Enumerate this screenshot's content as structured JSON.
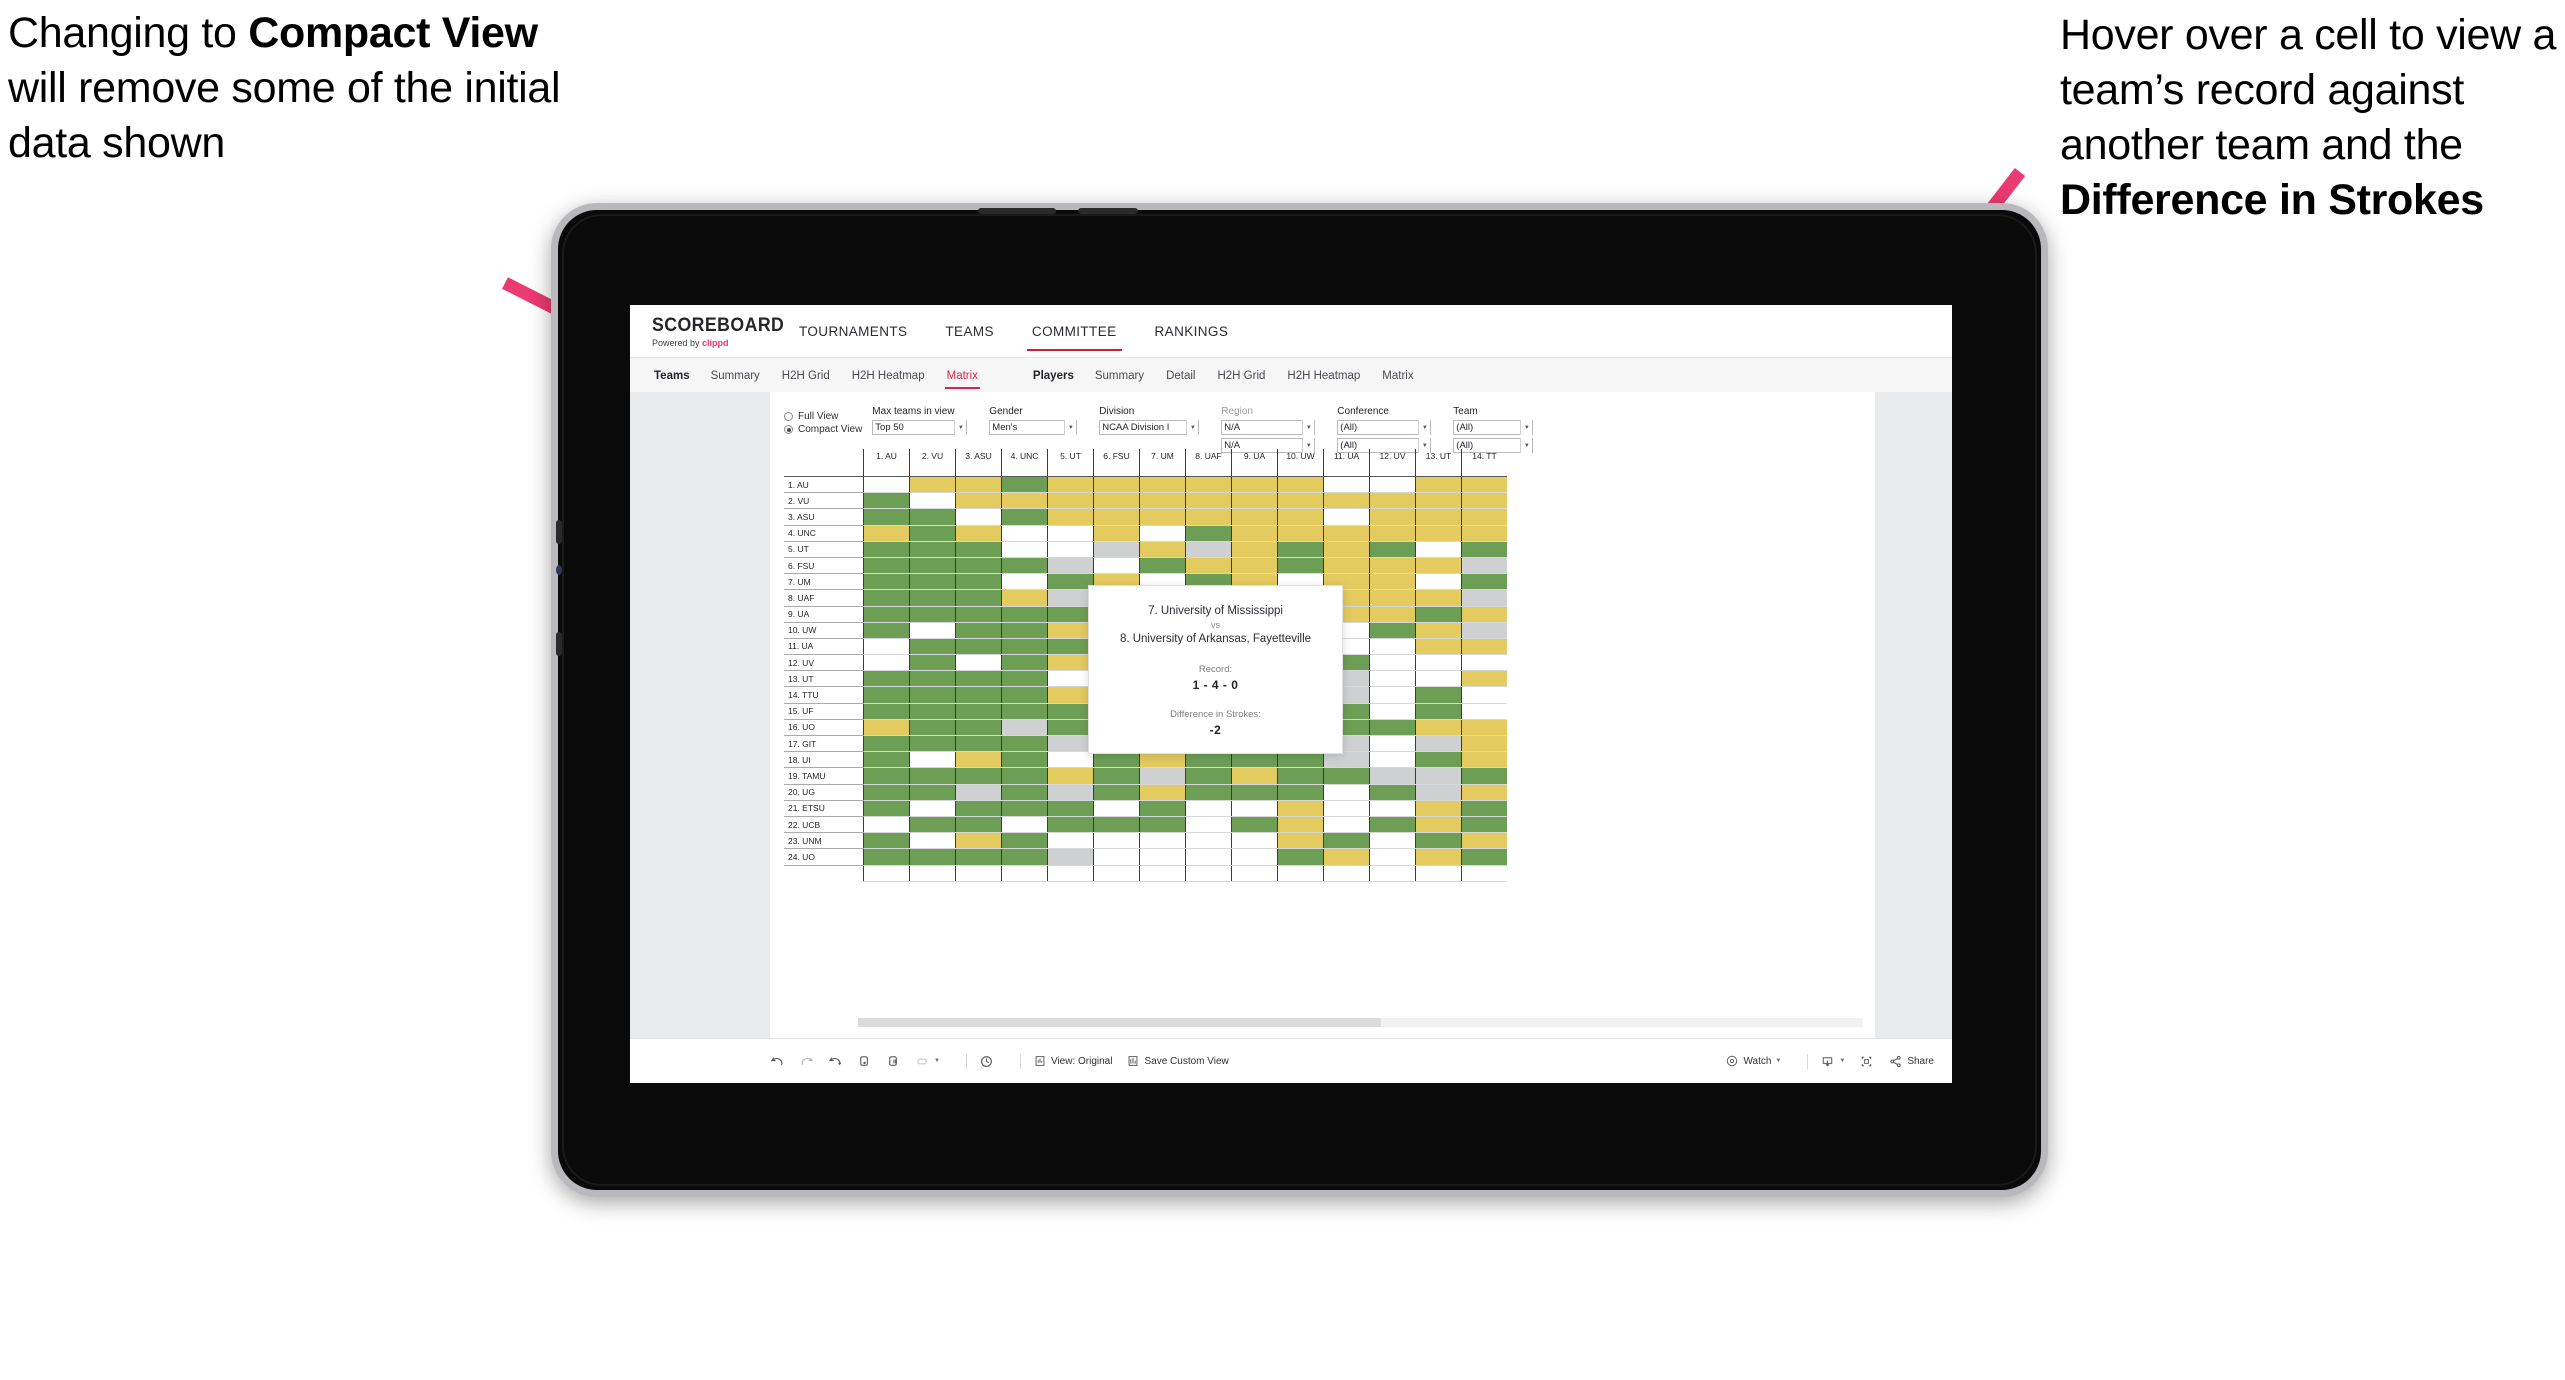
{
  "annotations": {
    "left": {
      "pre": "Changing to ",
      "bold": "Compact View",
      "post": " will remove some of the initial data shown"
    },
    "right": {
      "pre": "Hover over a cell to view a team’s record against another team and the ",
      "bold": "Difference in Strokes",
      "post": ""
    },
    "arrow_color": "#ec3a72"
  },
  "brand": {
    "logo": "SCOREBOARD",
    "tagline_pre": "Powered by ",
    "tagline_brand": "clippd"
  },
  "topnav": {
    "items": [
      {
        "label": "TOURNAMENTS",
        "active": false
      },
      {
        "label": "TEAMS",
        "active": false
      },
      {
        "label": "COMMITTEE",
        "active": true
      },
      {
        "label": "RANKINGS",
        "active": false
      }
    ]
  },
  "subnav": {
    "teams_group_label": "Teams",
    "teams_items": [
      {
        "label": "Summary",
        "active": false
      },
      {
        "label": "H2H Grid",
        "active": false
      },
      {
        "label": "H2H Heatmap",
        "active": false
      },
      {
        "label": "Matrix",
        "active": true
      }
    ],
    "players_group_label": "Players",
    "players_items": [
      {
        "label": "Summary",
        "active": false
      },
      {
        "label": "Detail",
        "active": false
      },
      {
        "label": "H2H Grid",
        "active": false
      },
      {
        "label": "H2H Heatmap",
        "active": false
      },
      {
        "label": "Matrix",
        "active": false
      }
    ]
  },
  "filters": {
    "view_mode": {
      "full_label": "Full View",
      "compact_label": "Compact View",
      "selected": "Compact View"
    },
    "max_teams": {
      "label": "Max teams in view",
      "value": "Top 50"
    },
    "gender": {
      "label": "Gender",
      "value": "Men's"
    },
    "division": {
      "label": "Division",
      "value": "NCAA Division I"
    },
    "region": {
      "label": "Region",
      "value1": "N/A",
      "value2": "N/A"
    },
    "conference": {
      "label": "Conference",
      "value1": "(All)",
      "value2": "(All)"
    },
    "team": {
      "label": "Team",
      "value1": "(All)",
      "value2": "(All)"
    }
  },
  "matrix": {
    "columns": [
      "1. AU",
      "2. VU",
      "3. ASU",
      "4. UNC",
      "5. UT",
      "6. FSU",
      "7. UM",
      "8. UAF",
      "9. UA",
      "10. UW",
      "11. UA",
      "12. UV",
      "13. UT",
      "14. TT"
    ],
    "rows": [
      "1. AU",
      "2. VU",
      "3. ASU",
      "4. UNC",
      "5. UT",
      "6. FSU",
      "7. UM",
      "8. UAF",
      "9. UA",
      "10. UW",
      "11. UA",
      "12. UV",
      "13. UT",
      "14. TTU",
      "15. UF",
      "16. UO",
      "17. GIT",
      "18. UI",
      "19. TAMU",
      "20. UG",
      "21. ETSU",
      "22. UCB",
      "23. UNM",
      "24. UO"
    ],
    "legend": {
      "win": "#6d9e55",
      "loss": "#e3cb5f",
      "tie": "#cfd0d2",
      "none": "#ffffff"
    },
    "cells": [
      [
        "w",
        "y",
        "y",
        "g",
        "y",
        "y",
        "y",
        "y",
        "y",
        "y",
        "w",
        "w",
        "y",
        "y"
      ],
      [
        "g",
        "w",
        "y",
        "y",
        "y",
        "y",
        "y",
        "y",
        "y",
        "y",
        "y",
        "y",
        "y",
        "y"
      ],
      [
        "g",
        "g",
        "w",
        "g",
        "y",
        "y",
        "y",
        "y",
        "y",
        "y",
        "w",
        "y",
        "y",
        "y"
      ],
      [
        "y",
        "g",
        "y",
        "w",
        "w",
        "y",
        "w",
        "g",
        "y",
        "y",
        "y",
        "y",
        "y",
        "y"
      ],
      [
        "g",
        "g",
        "g",
        "w",
        "w",
        "a",
        "y",
        "a",
        "y",
        "g",
        "y",
        "g",
        "w",
        "g"
      ],
      [
        "g",
        "g",
        "g",
        "g",
        "a",
        "w",
        "g",
        "y",
        "y",
        "g",
        "y",
        "y",
        "y",
        "a"
      ],
      [
        "g",
        "g",
        "g",
        "w",
        "g",
        "y",
        "w",
        "g",
        "y",
        "w",
        "y",
        "y",
        "w",
        "g"
      ],
      [
        "g",
        "g",
        "g",
        "y",
        "a",
        "g",
        "y",
        "w",
        "y",
        "y",
        "y",
        "y",
        "y",
        "a"
      ],
      [
        "g",
        "g",
        "g",
        "g",
        "g",
        "g",
        "g",
        "y",
        "w",
        "y",
        "y",
        "y",
        "g",
        "y"
      ],
      [
        "g",
        "w",
        "g",
        "g",
        "y",
        "y",
        "w",
        "g",
        "y",
        "w",
        "w",
        "g",
        "y",
        "a"
      ],
      [
        "w",
        "g",
        "g",
        "g",
        "g",
        "g",
        "g",
        "g",
        "g",
        "w",
        "w",
        "w",
        "y",
        "y"
      ],
      [
        "w",
        "g",
        "w",
        "g",
        "y",
        "g",
        "y",
        "g",
        "g",
        "g",
        "g",
        "w",
        "w",
        "w"
      ],
      [
        "g",
        "g",
        "g",
        "g",
        "w",
        "g",
        "g",
        "g",
        "g",
        "g",
        "a",
        "w",
        "w",
        "y"
      ],
      [
        "g",
        "g",
        "g",
        "g",
        "y",
        "a",
        "y",
        "g",
        "g",
        "g",
        "a",
        "w",
        "g",
        "w"
      ],
      [
        "g",
        "g",
        "g",
        "g",
        "g",
        "g",
        "a",
        "g",
        "g",
        "g",
        "g",
        "w",
        "g",
        "w"
      ],
      [
        "y",
        "g",
        "g",
        "a",
        "g",
        "a",
        "y",
        "g",
        "g",
        "g",
        "g",
        "g",
        "y",
        "y"
      ],
      [
        "g",
        "g",
        "g",
        "g",
        "a",
        "g",
        "w",
        "g",
        "g",
        "g",
        "a",
        "w",
        "a",
        "y"
      ],
      [
        "g",
        "w",
        "y",
        "g",
        "w",
        "g",
        "y",
        "g",
        "g",
        "g",
        "a",
        "w",
        "g",
        "y"
      ],
      [
        "g",
        "g",
        "g",
        "g",
        "y",
        "g",
        "a",
        "g",
        "y",
        "g",
        "g",
        "a",
        "a",
        "g"
      ],
      [
        "g",
        "g",
        "a",
        "g",
        "a",
        "g",
        "y",
        "g",
        "g",
        "g",
        "w",
        "g",
        "a",
        "y"
      ],
      [
        "g",
        "w",
        "g",
        "g",
        "g",
        "w",
        "g",
        "w",
        "w",
        "y",
        "w",
        "w",
        "y",
        "g"
      ],
      [
        "w",
        "g",
        "g",
        "w",
        "g",
        "g",
        "g",
        "w",
        "g",
        "y",
        "w",
        "g",
        "y",
        "g"
      ],
      [
        "g",
        "w",
        "y",
        "g",
        "w",
        "w",
        "w",
        "w",
        "w",
        "y",
        "g",
        "w",
        "g",
        "y"
      ],
      [
        "g",
        "g",
        "g",
        "g",
        "a",
        "w",
        "w",
        "w",
        "w",
        "g",
        "y",
        "w",
        "y",
        "g"
      ]
    ]
  },
  "tooltip": {
    "team_a": "7. University of Mississippi",
    "vs": "vs",
    "team_b": "8. University of Arkansas, Fayetteville",
    "record_label": "Record:",
    "record_value": "1 - 4 - 0",
    "strokes_label": "Difference in Strokes:",
    "strokes_value": "-2"
  },
  "toolbar": {
    "undo": "undo-icon",
    "redo": "redo-icon",
    "revert": "revert-icon",
    "refresh": "refresh-data-icon",
    "pause": "pause-auto-update-icon",
    "highlight": "highlight-icon",
    "clock": "pause-icon",
    "view_original": "View: Original",
    "save_custom_view": "Save Custom View",
    "watch": "Watch",
    "share": "Share"
  }
}
